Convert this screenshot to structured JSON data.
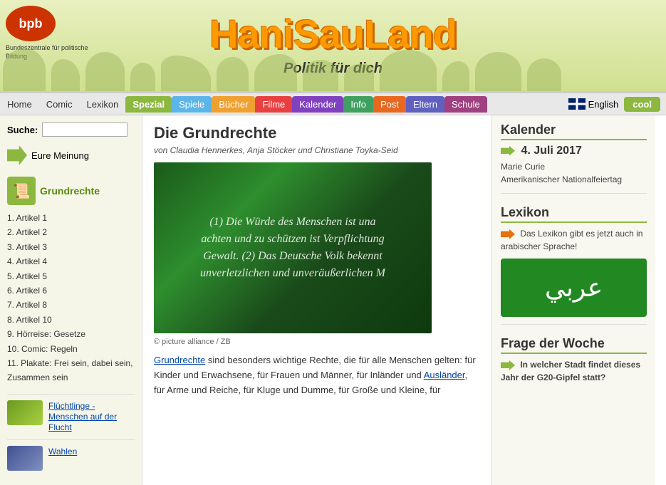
{
  "header": {
    "site_title": "HaniSauLand",
    "subtitle": "Politik für dich",
    "bpb_label": "bpb",
    "bpb_fulltext": "Bundeszentrale für politische Bildung"
  },
  "navbar": {
    "items": [
      {
        "label": "Home",
        "class": ""
      },
      {
        "label": "Comic",
        "class": ""
      },
      {
        "label": "Lexikon",
        "class": ""
      },
      {
        "label": "Spezial",
        "class": "spezial active"
      },
      {
        "label": "Spiele",
        "class": "spiele"
      },
      {
        "label": "Bücher",
        "class": "buecher"
      },
      {
        "label": "Filme",
        "class": "filme"
      },
      {
        "label": "Kalender",
        "class": "kalender"
      },
      {
        "label": "Info",
        "class": "info"
      },
      {
        "label": "Post",
        "class": "post"
      },
      {
        "label": "Eltern",
        "class": "eltern"
      },
      {
        "label": "Schule",
        "class": "schule"
      }
    ],
    "english_label": "English",
    "cool_label": "cool"
  },
  "sidebar": {
    "search_label": "Suche:",
    "search_placeholder": "",
    "meinung_label": "Eure Meinung",
    "section_title": "Grundrechte",
    "list_items": [
      {
        "label": "1. Artikel 1"
      },
      {
        "label": "2. Artikel 2"
      },
      {
        "label": "3. Artikel 3"
      },
      {
        "label": "4. Artikel 4"
      },
      {
        "label": "5. Artikel 5"
      },
      {
        "label": "6. Artikel 6"
      },
      {
        "label": "7. Artikel 8"
      },
      {
        "label": "8. Artikel 10"
      },
      {
        "label": "9. Hörreise: Gesetze"
      },
      {
        "label": "10. Comic: Regeln"
      },
      {
        "label": "11. Plakate: Frei sein, dabei sein, Zusammen sein"
      }
    ],
    "bottom_items": [
      {
        "label": "Flüchtlinge - Menschen auf der Flucht"
      },
      {
        "label": "Wahlen"
      }
    ]
  },
  "article": {
    "title": "Die Grundrechte",
    "authors": "von Claudia Hennerkes, Anja Stöcker und Christiane Toyka-Seid",
    "image_text": "(1) Die Würde des Menschen ist una achten und zu schützen ist Verpflichtung Gewalt. (2) Das Deutsche Volk bekennt unverletzlichen und unveräußerlichen M",
    "caption": "© picture alliance / ZB",
    "body_html": "<a href='#'>Grundrechte</a> sind besonders wichtige Rechte, die für alle Menschen gelten: für Kinder und Erwachsene, für Frauen und Männer, für Inländer und <a href='#'>Ausländer</a>, für Arme und Reiche, für Kluge und Dumme, für Große und Kleine, für"
  },
  "right_sidebar": {
    "kalender": {
      "section_title": "Kalender",
      "date": "4. Juli 2017",
      "events": [
        "Marie Curie",
        "Amerikanischer Nationalfeiertag"
      ]
    },
    "lexikon": {
      "section_title": "Lexikon",
      "text": "Das Lexikon gibt es jetzt auch in arabischer Sprache!",
      "arabic_text": "عربي"
    },
    "frage": {
      "section_title": "Frage der Woche",
      "text": "In welcher Stadt findet dieses Jahr der G20-Gipfel statt?"
    }
  }
}
